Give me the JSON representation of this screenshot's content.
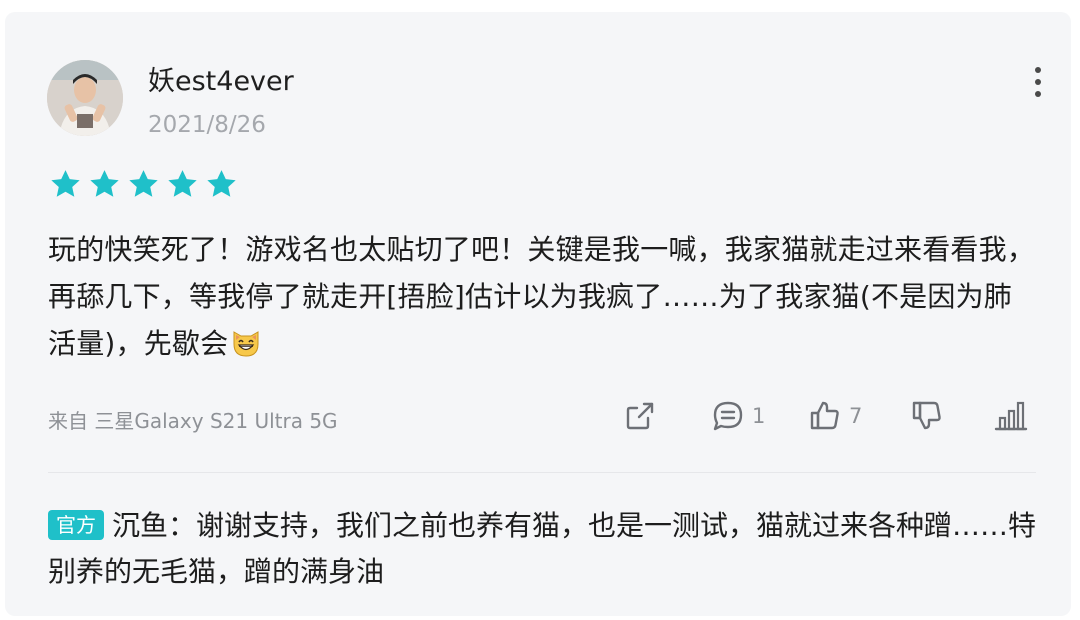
{
  "comment": {
    "username": "妖est4ever",
    "date": "2021/8/26",
    "rating": 5,
    "text": "玩的快笑死了！游戏名也太贴切了吧！关键是我一喊，我家猫就走过来看看我，再舔几下，等我停了就走开[捂脸]估计以为我疯了……为了我家猫(不是因为肺活量)，先歇会",
    "device": "来自 三星Galaxy S21 Ultra 5G",
    "actions": {
      "comment_count": "1",
      "like_count": "7"
    }
  },
  "reply": {
    "badge": "官方",
    "text": "沉鱼：谢谢支持，我们之前也养有猫，也是一测试，猫就过来各种蹭……特别养的无毛猫，蹭的满身油"
  },
  "colors": {
    "accent": "#1fc0c9",
    "background": "#f5f6f8",
    "icon": "#6d7076"
  }
}
